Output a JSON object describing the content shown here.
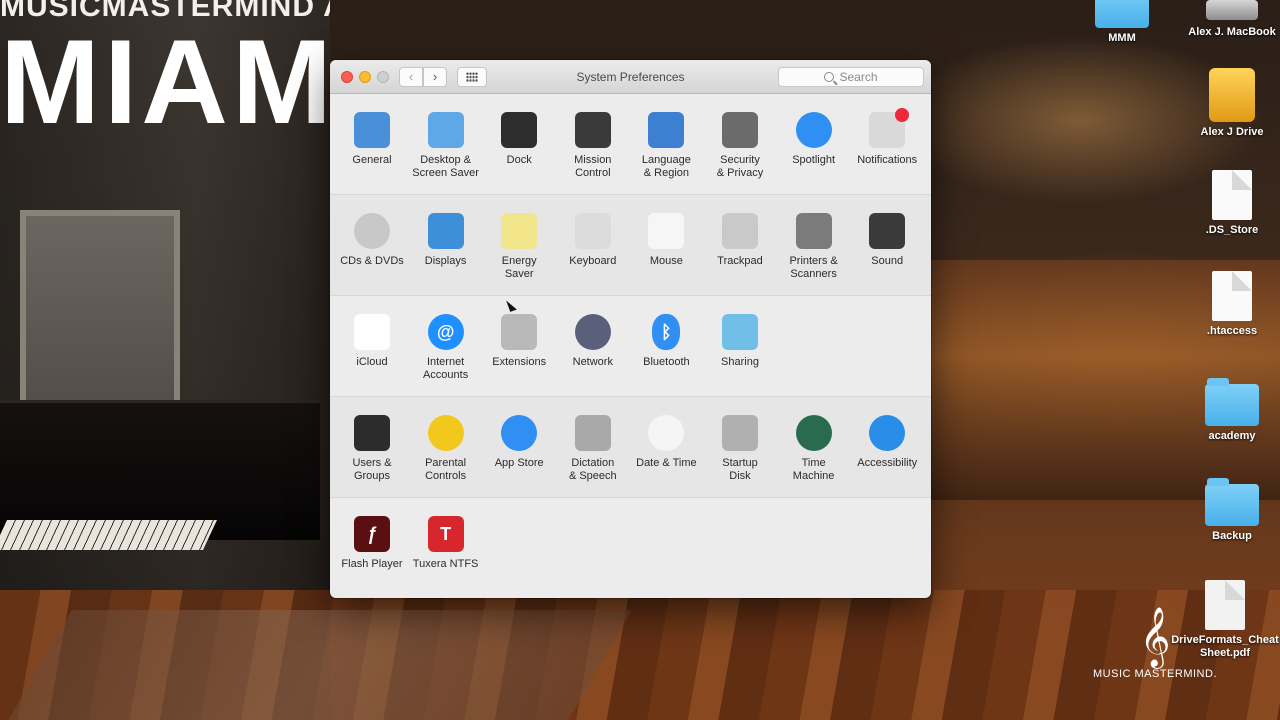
{
  "wallpaper": {
    "academy_text": "MUSICMASTERMIND ACADEMY",
    "city_text": "MIAMI",
    "brand_text": "MUSIC MASTERMIND."
  },
  "desktop_icons": [
    {
      "label": "MMM",
      "type": "folder"
    },
    {
      "label": "Alex J. MacBook",
      "type": "hard-drive"
    },
    {
      "label": "Alex J Drive",
      "type": "external-drive"
    },
    {
      "label": ".DS_Store",
      "type": "document"
    },
    {
      "label": ".htaccess",
      "type": "document"
    },
    {
      "label": "academy",
      "type": "folder"
    },
    {
      "label": "Backup",
      "type": "folder"
    },
    {
      "label": "DriveFormats_CheatSheet.pdf",
      "type": "pdf"
    }
  ],
  "window": {
    "title": "System Preferences",
    "search_placeholder": "Search",
    "nav_back": "‹",
    "nav_fwd": "›"
  },
  "sections": [
    [
      {
        "label": "General",
        "icon": "general-icon",
        "color": "#4a90d9"
      },
      {
        "label": "Desktop &\nScreen Saver",
        "icon": "desktop-screensaver-icon",
        "color": "#5fa8e8"
      },
      {
        "label": "Dock",
        "icon": "dock-icon",
        "color": "#2d2d2d"
      },
      {
        "label": "Mission\nControl",
        "icon": "mission-control-icon",
        "color": "#3a3a3a"
      },
      {
        "label": "Language\n& Region",
        "icon": "language-region-icon",
        "color": "#3d7fd1"
      },
      {
        "label": "Security\n& Privacy",
        "icon": "security-privacy-icon",
        "color": "#6b6b6b"
      },
      {
        "label": "Spotlight",
        "icon": "spotlight-icon",
        "color": "#2f8ff2"
      },
      {
        "label": "Notifications",
        "icon": "notifications-icon",
        "color": "#d9d9d9"
      }
    ],
    [
      {
        "label": "CDs & DVDs",
        "icon": "cd-dvd-icon",
        "color": "#c8c8c8"
      },
      {
        "label": "Displays",
        "icon": "displays-icon",
        "color": "#3c8fd8"
      },
      {
        "label": "Energy\nSaver",
        "icon": "energy-saver-icon",
        "color": "#f3e58a"
      },
      {
        "label": "Keyboard",
        "icon": "keyboard-icon",
        "color": "#dcdcdc"
      },
      {
        "label": "Mouse",
        "icon": "mouse-icon",
        "color": "#f6f6f6"
      },
      {
        "label": "Trackpad",
        "icon": "trackpad-icon",
        "color": "#c9c9c9"
      },
      {
        "label": "Printers &\nScanners",
        "icon": "printer-scanner-icon",
        "color": "#7b7b7b"
      },
      {
        "label": "Sound",
        "icon": "sound-icon",
        "color": "#3a3a3a"
      }
    ],
    [
      {
        "label": "iCloud",
        "icon": "icloud-icon",
        "color": "#ffffff"
      },
      {
        "label": "Internet\nAccounts",
        "icon": "internet-accounts-icon",
        "color": "#1e90ff"
      },
      {
        "label": "Extensions",
        "icon": "extensions-icon",
        "color": "#b9b9b9"
      },
      {
        "label": "Network",
        "icon": "network-icon",
        "color": "#5a5f7a"
      },
      {
        "label": "Bluetooth",
        "icon": "bluetooth-icon",
        "color": "#2f8ff2"
      },
      {
        "label": "Sharing",
        "icon": "sharing-icon",
        "color": "#6fbfe8"
      }
    ],
    [
      {
        "label": "Users &\nGroups",
        "icon": "users-groups-icon",
        "color": "#2c2c2c"
      },
      {
        "label": "Parental\nControls",
        "icon": "parental-controls-icon",
        "color": "#f3c81c"
      },
      {
        "label": "App Store",
        "icon": "app-store-icon",
        "color": "#2f8ff2"
      },
      {
        "label": "Dictation\n& Speech",
        "icon": "dictation-speech-icon",
        "color": "#a9a9a9"
      },
      {
        "label": "Date & Time",
        "icon": "date-time-icon",
        "color": "#f5f5f5"
      },
      {
        "label": "Startup\nDisk",
        "icon": "startup-disk-icon",
        "color": "#b0b0b0"
      },
      {
        "label": "Time\nMachine",
        "icon": "time-machine-icon",
        "color": "#2a6b4e"
      },
      {
        "label": "Accessibility",
        "icon": "accessibility-icon",
        "color": "#2a8ee8"
      }
    ],
    [
      {
        "label": "Flash Player",
        "icon": "flash-player-icon",
        "color": "#5a0f10"
      },
      {
        "label": "Tuxera NTFS",
        "icon": "tuxera-ntfs-icon",
        "color": "#d8262e"
      }
    ]
  ]
}
